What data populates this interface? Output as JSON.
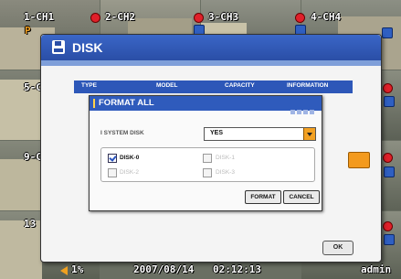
{
  "cameras": [
    {
      "label": "1-CH1"
    },
    {
      "label": "2-CH2"
    },
    {
      "label": "3-CH3"
    },
    {
      "label": "4-CH4"
    },
    {
      "label": "5-C"
    },
    {
      "label": "9-C"
    },
    {
      "label": "13"
    }
  ],
  "ch1_marker": "P",
  "disk_window": {
    "title": "DISK",
    "columns": [
      "TYPE",
      "MODEL",
      "CAPACITY",
      "INFORMATION"
    ],
    "ok_label": "OK"
  },
  "format_dialog": {
    "title": "FORMAT ALL",
    "system_disk_label": "I SYSTEM DISK",
    "system_disk_value": "YES",
    "disks": [
      {
        "label": "DISK-0",
        "checked": true,
        "enabled": true
      },
      {
        "label": "DISK-1",
        "checked": false,
        "enabled": false
      },
      {
        "label": "DISK-2",
        "checked": false,
        "enabled": false
      },
      {
        "label": "DISK-3",
        "checked": false,
        "enabled": false
      }
    ],
    "format_label": "FORMAT",
    "cancel_label": "CANCEL"
  },
  "status_bar": {
    "volume": "1%",
    "date": "2007/08/14",
    "time": "02:12:13",
    "user": "admin"
  },
  "colors": {
    "title_blue": "#2a4ea6",
    "accent_orange": "#f39a1e",
    "record_red": "#e0202a"
  }
}
